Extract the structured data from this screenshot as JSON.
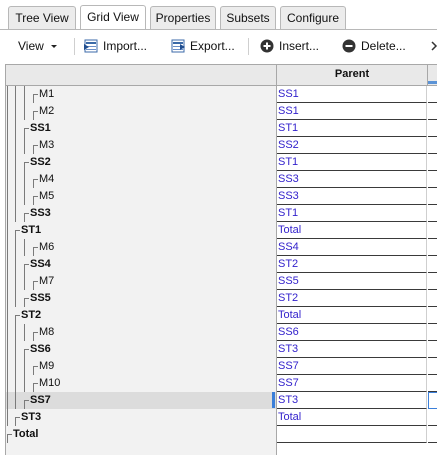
{
  "tabs": [
    "Tree View",
    "Grid View",
    "Properties",
    "Subsets",
    "Configure"
  ],
  "active_tab": "Grid View",
  "toolbar": {
    "view_label": "View",
    "import_label": "Import...",
    "export_label": "Export...",
    "insert_label": "Insert...",
    "delete_label": "Delete..."
  },
  "grid": {
    "column_header": "Parent",
    "rows": [
      {
        "name": "M1",
        "parent": "SS1",
        "bold": false
      },
      {
        "name": "M2",
        "parent": "SS1",
        "bold": false
      },
      {
        "name": "SS1",
        "parent": "ST1",
        "bold": true
      },
      {
        "name": "M3",
        "parent": "SS2",
        "bold": false
      },
      {
        "name": "SS2",
        "parent": "ST1",
        "bold": true
      },
      {
        "name": "M4",
        "parent": "SS3",
        "bold": false
      },
      {
        "name": "M5",
        "parent": "SS3",
        "bold": false
      },
      {
        "name": "SS3",
        "parent": "ST1",
        "bold": true
      },
      {
        "name": "ST1",
        "parent": "Total",
        "bold": true
      },
      {
        "name": "M6",
        "parent": "SS4",
        "bold": false
      },
      {
        "name": "SS4",
        "parent": "ST2",
        "bold": true
      },
      {
        "name": "M7",
        "parent": "SS5",
        "bold": false
      },
      {
        "name": "SS5",
        "parent": "ST2",
        "bold": true
      },
      {
        "name": "ST2",
        "parent": "Total",
        "bold": true
      },
      {
        "name": "M8",
        "parent": "SS6",
        "bold": false
      },
      {
        "name": "SS6",
        "parent": "ST3",
        "bold": true
      },
      {
        "name": "M9",
        "parent": "SS7",
        "bold": false
      },
      {
        "name": "M10",
        "parent": "SS7",
        "bold": false
      },
      {
        "name": "SS7",
        "parent": "ST3",
        "bold": true
      },
      {
        "name": "ST3",
        "parent": "Total",
        "bold": true
      },
      {
        "name": "Total",
        "parent": "",
        "bold": true
      }
    ],
    "selected_row": "SS7"
  }
}
